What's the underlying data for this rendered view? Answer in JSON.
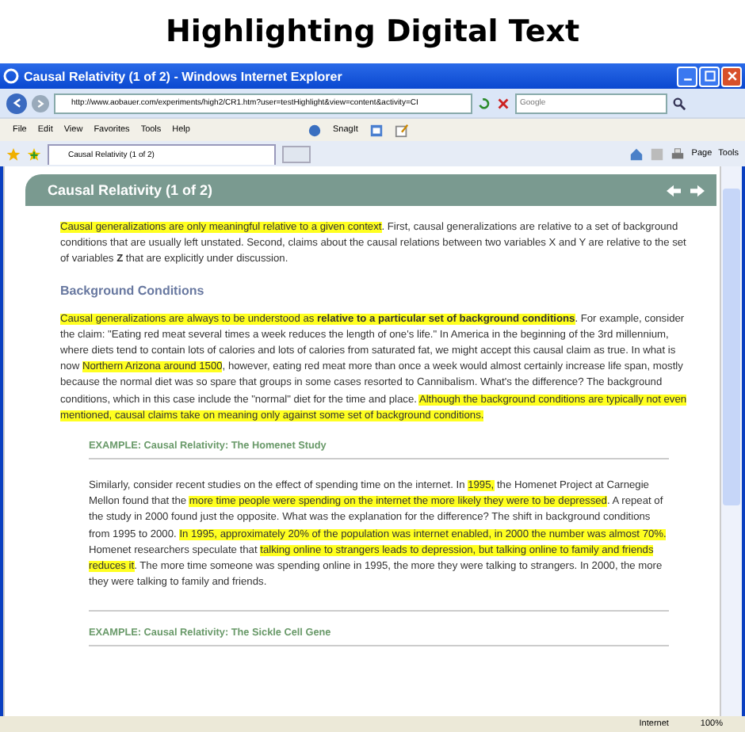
{
  "heading": "Highlighting Digital Text",
  "browser": {
    "title": "Causal Relativity (1 of 2) - Windows Internet Explorer",
    "address": "http://www.aobauer.com/experiments/high2/CR1.htm?user=testHighlight&view=content&activity=CI",
    "search_placeholder": "Google",
    "menu": [
      "File",
      "Edit",
      "View",
      "Favorites",
      "Tools",
      "Help"
    ],
    "toolbar_items": [
      "SnagIt"
    ],
    "tab": {
      "label": "Causal Relativity (1 of 2)"
    },
    "commands": [
      "Page",
      "Tools"
    ],
    "status": [
      "Internet",
      "100%"
    ]
  },
  "page": {
    "title": "Causal Relativity (1 of 2)",
    "blocks": [
      {
        "kind": "paragraph",
        "segments": [
          {
            "text": "Causal generalizations are only meaningful relative to a given context",
            "highlighted": true
          },
          {
            "text": ". First, causal generalizations are relative to a set of background conditions that are usually left unstated. Second, claims about the causal relations between two variables X and Y are relative to the set of variables **Z** that are explicitly under discussion.",
            "highlighted": false
          }
        ]
      },
      {
        "kind": "subheading",
        "text": "Background Conditions"
      },
      {
        "kind": "paragraph",
        "segments": [
          {
            "text": "Causal generalizations are always to be understood as **relative to a particular set of background conditions**",
            "highlighted": true
          },
          {
            "text": ". For example, consider the claim: \"Eating red meat several times a week reduces the length of one's life.\" In America in the beginning of the 3rd millennium, where diets tend to contain lots of calories and lots of calories from saturated fat, we might accept this causal claim as true. In what is now ",
            "highlighted": false
          },
          {
            "text": "Northern Arizona around 1500",
            "highlighted": true
          },
          {
            "text": ", however, eating red meat more than once a week would almost certainly increase life span, mostly because the normal diet was so spare that groups in some cases resorted to Cannibalism. What's the difference? The background conditions, which in this case include the \"normal\" diet for the time and place. ",
            "highlighted": false
          },
          {
            "text": "Although the background conditions are typically not even mentioned, causal claims take on meaning only against some set of background conditions.",
            "highlighted": true
          }
        ]
      },
      {
        "kind": "example",
        "title": "EXAMPLE: Causal Relativity: The Homenet Study",
        "segments": [
          {
            "text": "Similarly, consider recent studies on the effect of spending time on the internet. In ",
            "highlighted": false
          },
          {
            "text": "1995,",
            "highlighted": true
          },
          {
            "text": " the Homenet Project at Carnegie Mellon found that the ",
            "highlighted": false
          },
          {
            "text": "more time people were spending on the internet the more likely they were to be depressed",
            "highlighted": true
          },
          {
            "text": ". A repeat of the study in 2000 found just the opposite. What was the explanation for the difference? The shift in background conditions from 1995 to 2000. ",
            "highlighted": false
          },
          {
            "text": "In 1995, approximately 20% of the population was internet enabled, in 2000 the number was almost 70%.",
            "highlighted": true
          },
          {
            "text": " Homenet researchers speculate that ",
            "highlighted": false
          },
          {
            "text": "talking online to strangers leads to depression, but talking online to family and friends reduces it",
            "highlighted": true
          },
          {
            "text": ". The more time someone was spending online in 1995, the more they were talking to strangers. In 2000, the more they were talking to family and friends.",
            "highlighted": false
          }
        ]
      },
      {
        "kind": "example",
        "title": "EXAMPLE: Causal Relativity: The Sickle Cell Gene"
      }
    ]
  }
}
